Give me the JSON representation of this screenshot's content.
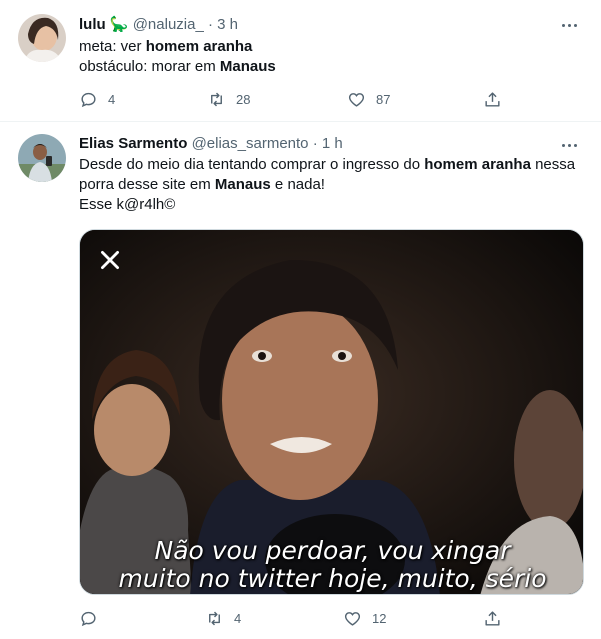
{
  "tweets": [
    {
      "name": "lulu",
      "emoji": "🦕",
      "handle": "@naluzia_",
      "sep": "·",
      "time": "3 h",
      "lines": [
        [
          {
            "t": "meta: ver "
          },
          {
            "t": "homem aranha",
            "b": true
          }
        ],
        [
          {
            "t": "obstáculo: morar em "
          },
          {
            "t": "Manaus",
            "b": true
          }
        ]
      ],
      "actions": {
        "reply": "4",
        "retweet": "28",
        "like": "87",
        "share": ""
      }
    },
    {
      "name": "Elias Sarmento",
      "emoji": "",
      "handle": "@elias_sarmento",
      "sep": "·",
      "time": "1 h",
      "lines": [
        [
          {
            "t": "Desde do meio dia tentando comprar o ingresso do "
          },
          {
            "t": "homem aranha",
            "b": true
          },
          {
            "t": " nessa"
          }
        ],
        [
          {
            "t": "porra desse site em "
          },
          {
            "t": "Manaus",
            "b": true
          },
          {
            "t": " e nada!"
          }
        ],
        [
          {
            "t": "Esse k@r4lh©"
          }
        ]
      ],
      "media": {
        "subtitle_line1": "Não vou perdoar, vou xingar",
        "subtitle_line2": "muito no twitter hoje, muito, sério"
      },
      "actions": {
        "reply": "",
        "retweet": "4",
        "like": "12",
        "share": ""
      }
    }
  ],
  "icons": {
    "more": "more-horizontal-icon",
    "reply": "reply-icon",
    "retweet": "retweet-icon",
    "like": "heart-icon",
    "share": "share-icon",
    "close": "close-icon"
  },
  "colors": {
    "text": "#0f1419",
    "secondary": "#536471",
    "divider": "#eff3f4"
  }
}
